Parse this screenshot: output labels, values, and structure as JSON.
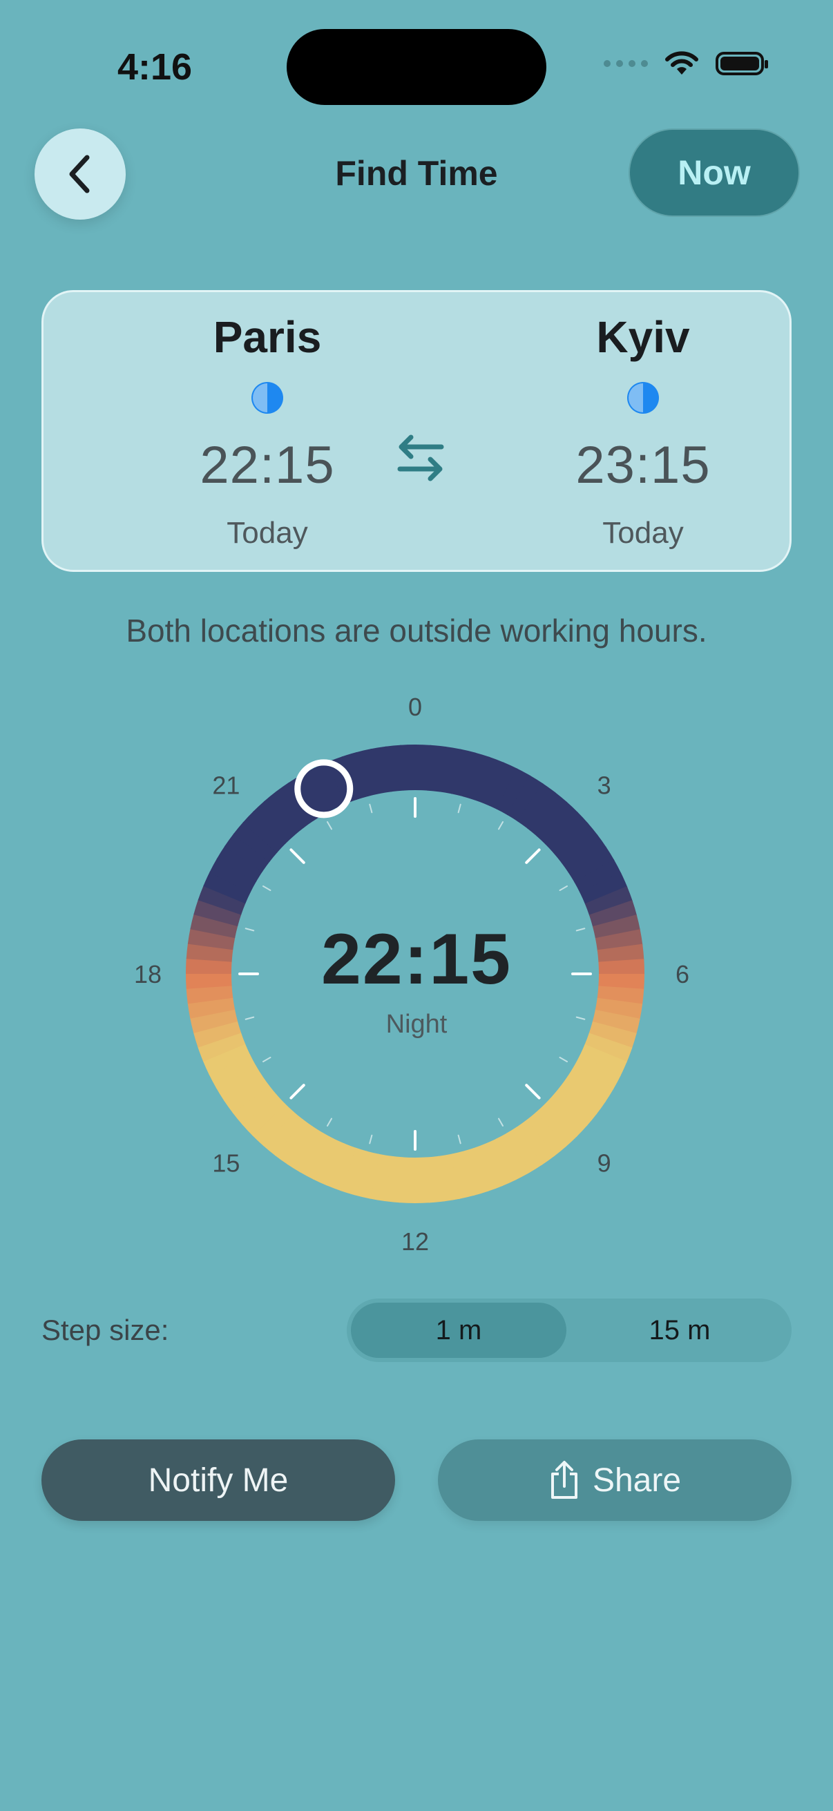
{
  "status_bar": {
    "time": "4:16"
  },
  "header": {
    "title": "Find Time",
    "now_label": "Now"
  },
  "locations": [
    {
      "city": "Paris",
      "time": "22:15",
      "day": "Today",
      "icon": "moon-icon"
    },
    {
      "city": "Kyiv",
      "time": "23:15",
      "day": "Today",
      "icon": "moon-icon"
    }
  ],
  "message": "Both locations are outside working hours.",
  "dial": {
    "time": "22:15",
    "period": "Night",
    "hours": [
      "0",
      "3",
      "6",
      "9",
      "12",
      "15",
      "18",
      "21"
    ],
    "selected_hour": 22.25
  },
  "step_size": {
    "label": "Step size:",
    "options": [
      "1 m",
      "15 m"
    ],
    "selected": "1 m"
  },
  "actions": {
    "notify": "Notify Me",
    "share": "Share"
  },
  "colors": {
    "background": "#6ab4bd",
    "night": "#30386a",
    "day": "#e9c970",
    "dusk": "#e07d55",
    "accent": "#327c84"
  }
}
